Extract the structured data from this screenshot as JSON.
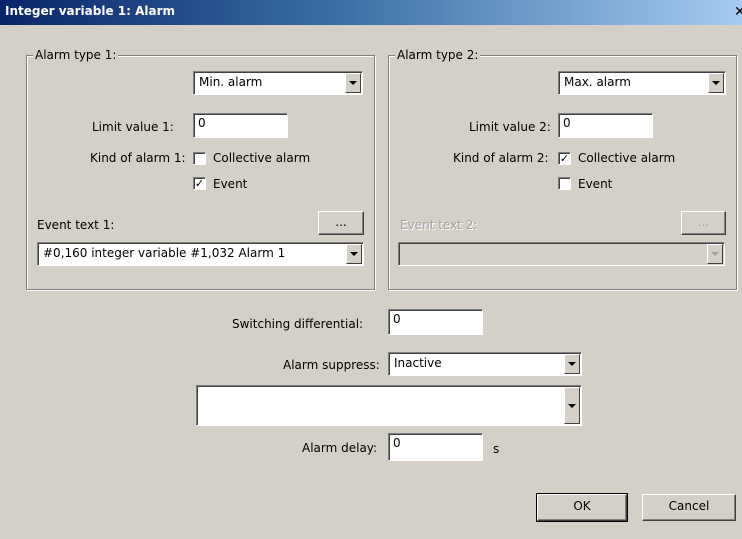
{
  "window": {
    "title": "Integer variable 1: Alarm",
    "close_glyph": "✕"
  },
  "group1": {
    "legend": "Alarm type 1:",
    "alarm_type_value": "Min. alarm",
    "limit_label": "Limit value 1:",
    "limit_value": "0",
    "kind_label": "Kind of alarm 1:",
    "collective_label": "Collective alarm",
    "collective_checked": false,
    "event_label": "Event",
    "event_checked": true,
    "event_text_label": "Event text 1:",
    "event_button": "...",
    "event_text_value": "#0,160 integer variable #1,032 Alarm 1"
  },
  "group2": {
    "legend": "Alarm type 2:",
    "alarm_type_value": "Max. alarm",
    "limit_label": "Limit value 2:",
    "limit_value": "0",
    "kind_label": "Kind of alarm 2:",
    "collective_label": "Collective alarm",
    "collective_checked": true,
    "event_label": "Event",
    "event_checked": false,
    "event_text_label": "Event text 2:",
    "event_button": "...",
    "event_text_value": ""
  },
  "bottom": {
    "switching_label": "Switching differential:",
    "switching_value": "0",
    "suppress_label": "Alarm suppress:",
    "suppress_value": "Inactive",
    "suppress_detail_value": "",
    "delay_label": "Alarm delay:",
    "delay_value": "0",
    "delay_unit": "s"
  },
  "buttons": {
    "ok": "OK",
    "cancel": "Cancel"
  }
}
